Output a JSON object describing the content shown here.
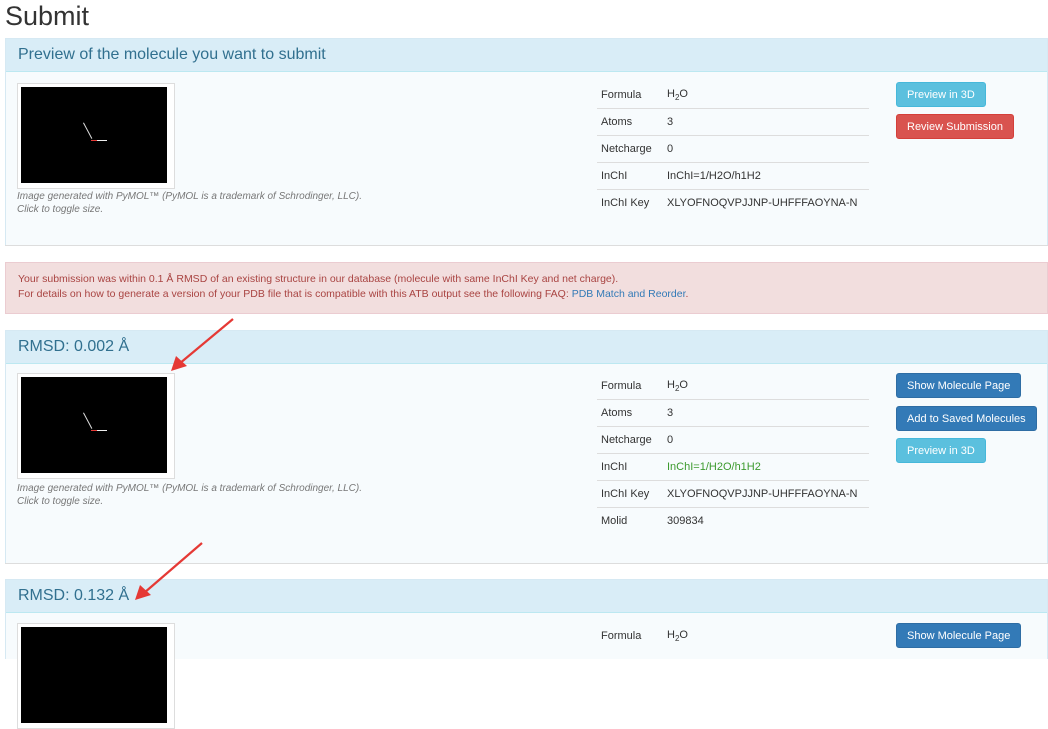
{
  "page": {
    "title": "Submit"
  },
  "preview": {
    "heading": "Preview of the molecule you want to submit",
    "caption_line1": "Image generated with PyMOL™ (PyMOL is a trademark of Schrodinger, LLC).",
    "caption_line2": "Click to toggle size.",
    "props": {
      "formula_key": "Formula",
      "formula_base": "H",
      "formula_sub": "2",
      "formula_tail": "O",
      "atoms_key": "Atoms",
      "atoms_val": "3",
      "netcharge_key": "Netcharge",
      "netcharge_val": "0",
      "inchi_key": "InChI",
      "inchi_val": "InChI=1/H2O/h1H2",
      "inchikey_key": "InChI Key",
      "inchikey_val": "XLYOFNOQVPJJNP-UHFFFAOYNA-N"
    },
    "buttons": {
      "preview3d": "Preview in 3D",
      "review": "Review Submission"
    }
  },
  "alert": {
    "line1": "Your submission was within 0.1 Å RMSD of an existing structure in our database (molecule with same InChI Key and net charge).",
    "line2": "For details on how to generate a version of your PDB file that is compatible with this ATB output see the following FAQ:",
    "link": "PDB Match and Reorder",
    "period": "."
  },
  "match1": {
    "heading": "RMSD: 0.002 Å",
    "caption_line1": "Image generated with PyMOL™ (PyMOL is a trademark of Schrodinger, LLC).",
    "caption_line2": "Click to toggle size.",
    "props": {
      "formula_key": "Formula",
      "formula_base": "H",
      "formula_sub": "2",
      "formula_tail": "O",
      "atoms_key": "Atoms",
      "atoms_val": "3",
      "netcharge_key": "Netcharge",
      "netcharge_val": "0",
      "inchi_key": "InChI",
      "inchi_val": "InChI=1/H2O/h1H2",
      "inchikey_key": "InChI Key",
      "inchikey_val": "XLYOFNOQVPJJNP-UHFFFAOYNA-N",
      "molid_key": "Molid",
      "molid_val": "309834"
    },
    "buttons": {
      "show": "Show Molecule Page",
      "add": "Add to Saved Molecules",
      "preview3d": "Preview in 3D"
    }
  },
  "match2": {
    "heading": "RMSD: 0.132 Å",
    "props": {
      "formula_key": "Formula",
      "formula_base": "H",
      "formula_sub": "2",
      "formula_tail": "O"
    },
    "buttons": {
      "show": "Show Molecule Page"
    }
  },
  "colors": {
    "inchi_match": "#3c9a2e",
    "arrow": "#e53935"
  }
}
